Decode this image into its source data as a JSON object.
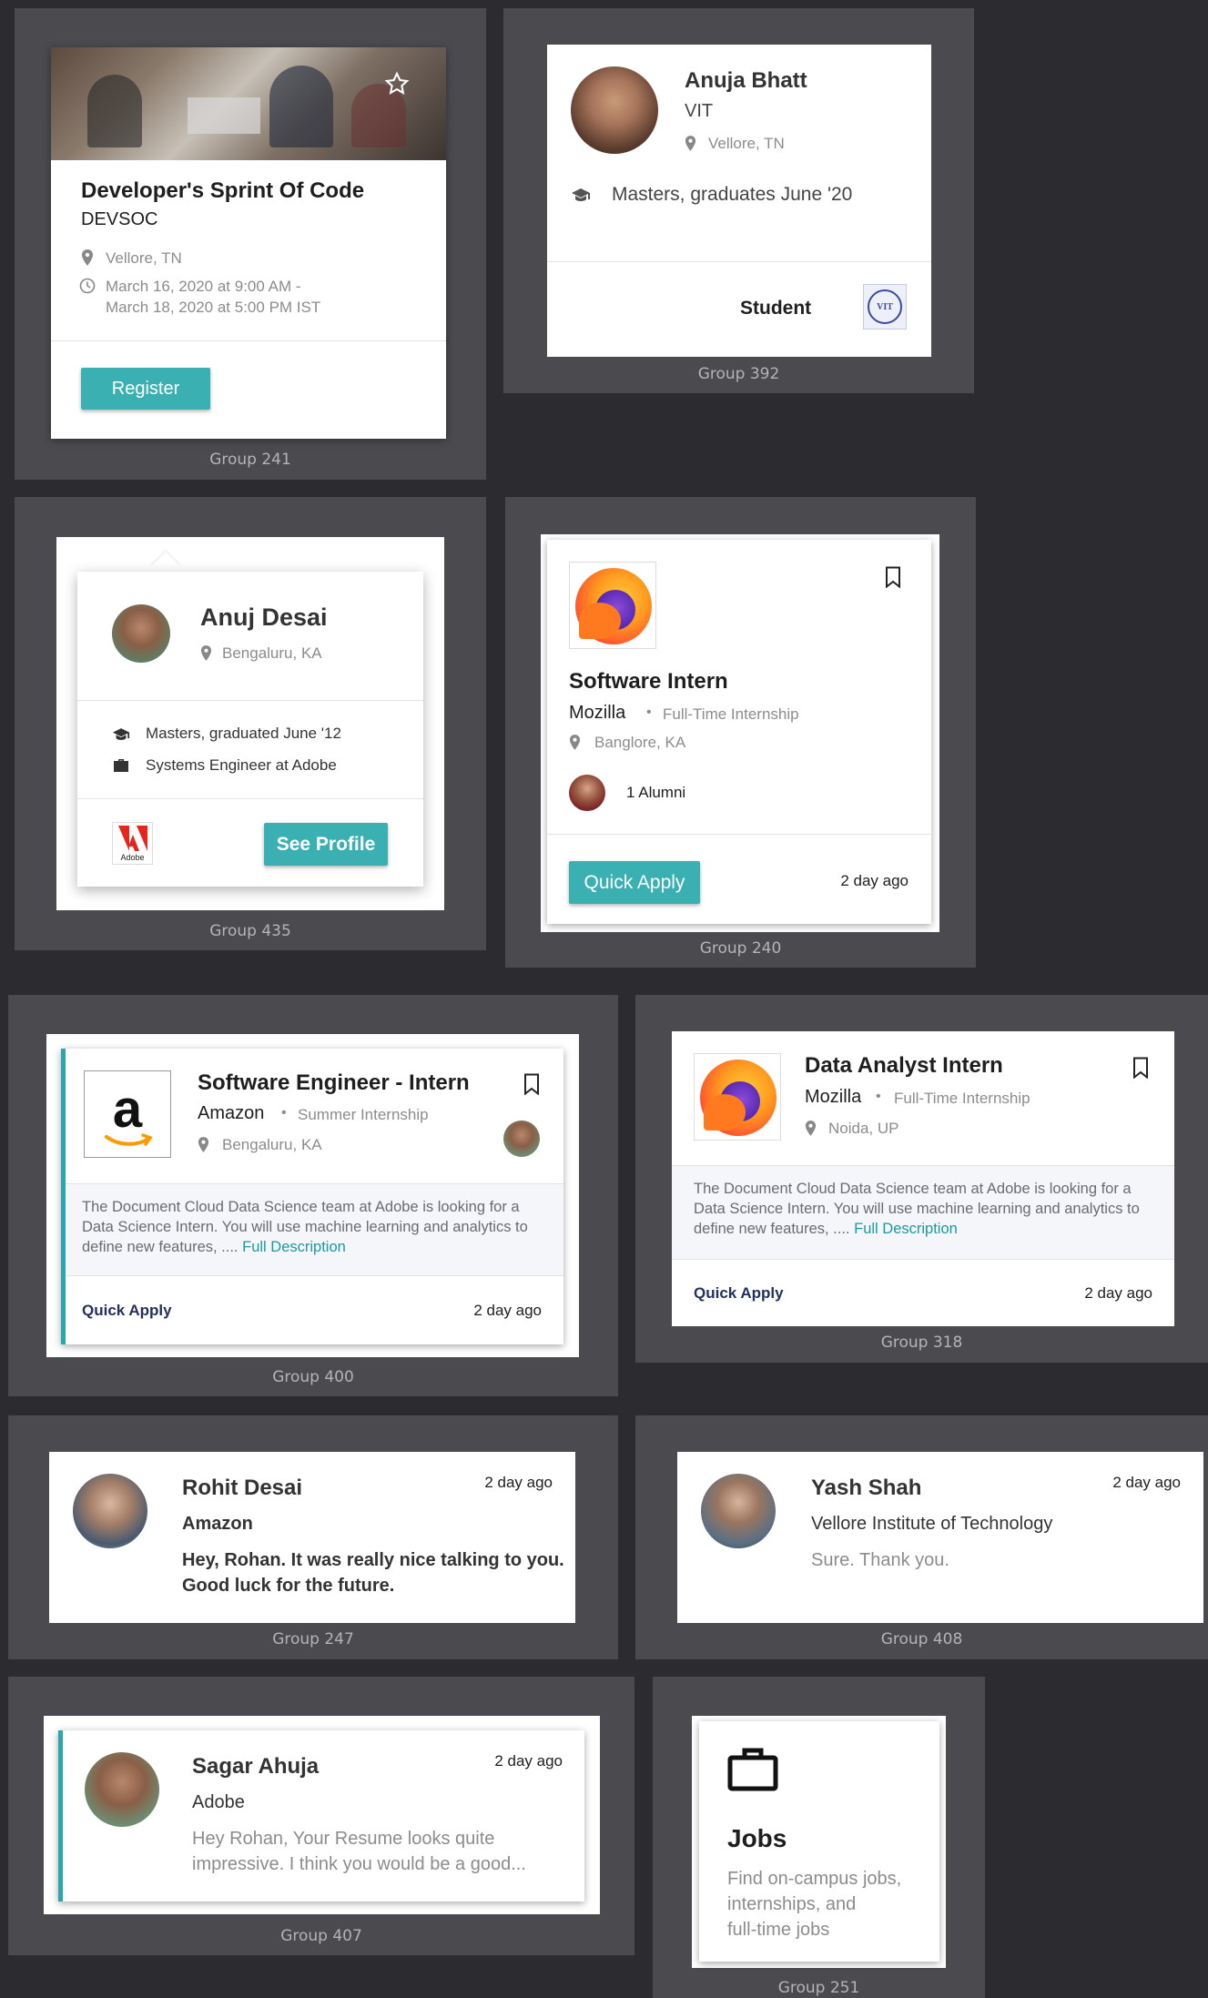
{
  "g241": {
    "label": "Group 241",
    "title": "Developer's Sprint Of Code",
    "org": "DEVSOC",
    "location": "Vellore, TN",
    "date_line1": "March 16, 2020 at 9:00 AM -",
    "date_line2": "March 18, 2020 at 5:00 PM IST",
    "button": "Register"
  },
  "g392": {
    "label": "Group 392",
    "name": "Anuja Bhatt",
    "school": "VIT",
    "location": "Vellore, TN",
    "degree": "Masters, graduates June '20",
    "role": "Student",
    "logo_text": "VIT"
  },
  "g435": {
    "label": "Group 435",
    "name": "Anuj Desai",
    "location": "Bengaluru, KA",
    "degree": "Masters, graduated June '12",
    "job": "Systems Engineer at Adobe",
    "logo_text": "Adobe",
    "button": "See Profile"
  },
  "g240": {
    "label": "Group 240",
    "title": "Software Intern",
    "company": "Mozilla",
    "type": "Full-Time Internship",
    "location": "Banglore, KA",
    "alumni": "1 Alumni",
    "button": "Quick Apply",
    "time": "2 day ago"
  },
  "g400": {
    "label": "Group 400",
    "title": "Software Engineer - Intern",
    "company": "Amazon",
    "type": "Summer Internship",
    "location": "Bengaluru, KA",
    "desc": "The Document Cloud Data Science team at Adobe is looking for a Data Science Intern. You will use machine learning and analytics to define new features, ....",
    "desc_link": "Full Description",
    "action": "Quick Apply",
    "time": "2 day ago"
  },
  "g318": {
    "label": "Group 318",
    "title": "Data Analyst Intern",
    "company": "Mozilla",
    "type": "Full-Time Internship",
    "location": "Noida, UP",
    "desc": "The Document Cloud Data Science team at Adobe is looking for a Data Science Intern. You will use machine learning and analytics to define new features, ....",
    "desc_link": "Full Description",
    "action": "Quick Apply",
    "time": "2 day ago"
  },
  "g247": {
    "label": "Group 247",
    "name": "Rohit Desai",
    "company": "Amazon",
    "message": "Hey, Rohan. It was really nice talking to you. Good luck for the future.",
    "time": "2 day ago"
  },
  "g408": {
    "label": "Group 408",
    "name": "Yash Shah",
    "company": "Vellore Institute of Technology",
    "message": "Sure. Thank you.",
    "time": "2 day ago"
  },
  "g407": {
    "label": "Group 407",
    "name": "Sagar Ahuja",
    "company": "Adobe",
    "message": "Hey Rohan, Your Resume looks quite impressive. I think you would be a good...",
    "time": "2 day ago"
  },
  "g251": {
    "label": "Group 251",
    "title": "Jobs",
    "desc_line1": "Find on-campus jobs,",
    "desc_line2": "internships, and",
    "desc_line3": "full-time jobs"
  },
  "colors": {
    "accent": "#3bb0b3",
    "link": "#1a9aa0",
    "background": "#2b2b30",
    "group_bg": "#4a4a4f"
  },
  "icons": [
    "star-icon",
    "location-pin-icon",
    "clock-icon",
    "graduation-cap-icon",
    "briefcase-icon",
    "bookmark-icon",
    "firefox-logo",
    "amazon-logo",
    "adobe-logo",
    "vit-logo"
  ]
}
